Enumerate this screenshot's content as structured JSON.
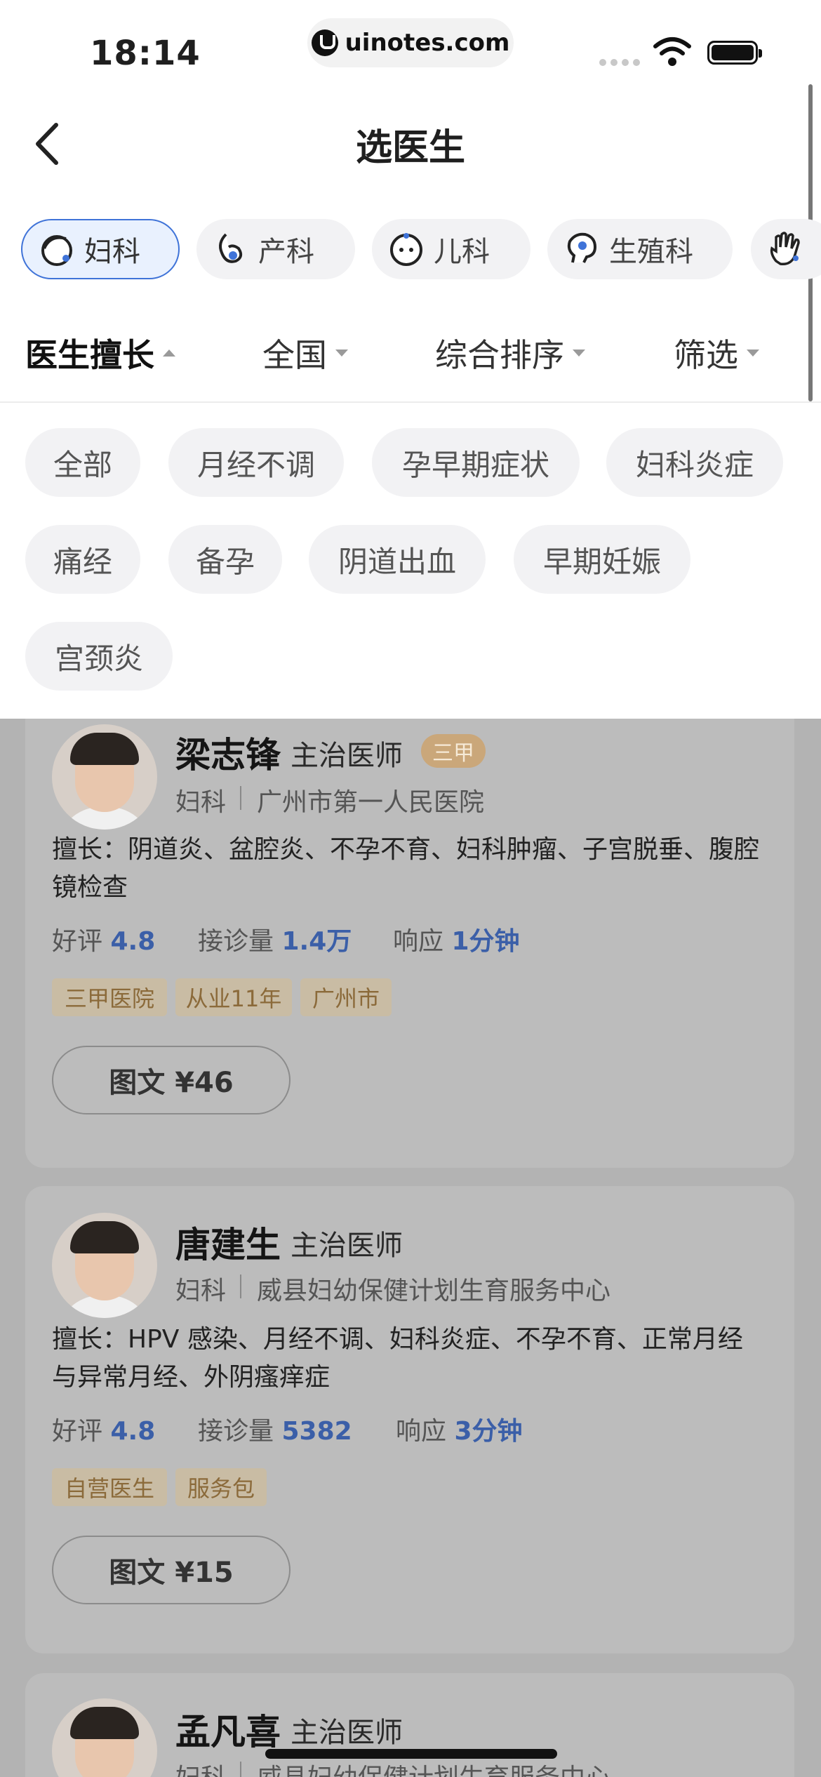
{
  "status_bar": {
    "time": "18:14",
    "url": "uinotes.com"
  },
  "nav": {
    "title": "选医生"
  },
  "categories": [
    {
      "label": "妇科",
      "icon": "woman-face-icon"
    },
    {
      "label": "产科",
      "icon": "pregnant-icon"
    },
    {
      "label": "儿科",
      "icon": "baby-face-icon"
    },
    {
      "label": "生殖科",
      "icon": "head-profile-icon"
    },
    {
      "label": "",
      "icon": "hand-icon"
    }
  ],
  "sort_bar": [
    "医生擅长",
    "全国",
    "综合排序",
    "筛选"
  ],
  "tags": [
    "全部",
    "月经不调",
    "孕早期症状",
    "妇科炎症",
    "痛经",
    "备孕",
    "阴道出血",
    "早期妊娠",
    "宫颈炎"
  ],
  "doctors": [
    {
      "name": "梁志锋",
      "title": "主治医师",
      "badge": "三甲",
      "dept": "妇科",
      "hospital": "广州市第一人民医院",
      "specialty": "擅长：阴道炎、盆腔炎、不孕不育、妇科肿瘤、子宫脱垂、腹腔镜检查",
      "rating_label": "好评",
      "rating": "4.8",
      "consult_label": "接诊量",
      "consults": "1.4万",
      "response_label": "响应",
      "response": "1分钟",
      "chips": [
        "三甲医院",
        "从业11年",
        "广州市"
      ],
      "price": "图文 ¥46"
    },
    {
      "name": "唐建生",
      "title": "主治医师",
      "badge": "",
      "dept": "妇科",
      "hospital": "威县妇幼保健计划生育服务中心",
      "specialty": "擅长：HPV 感染、月经不调、妇科炎症、不孕不育、正常月经与异常月经、外阴瘙痒症",
      "rating_label": "好评",
      "rating": "4.8",
      "consult_label": "接诊量",
      "consults": "5382",
      "response_label": "响应",
      "response": "3分钟",
      "chips": [
        "自营医生",
        "服务包"
      ],
      "price": "图文 ¥15"
    },
    {
      "name": "孟凡喜",
      "title": "主治医师",
      "badge": "",
      "dept": "妇科",
      "hospital": "威县妇幼保健计划生育服务中心"
    }
  ]
}
